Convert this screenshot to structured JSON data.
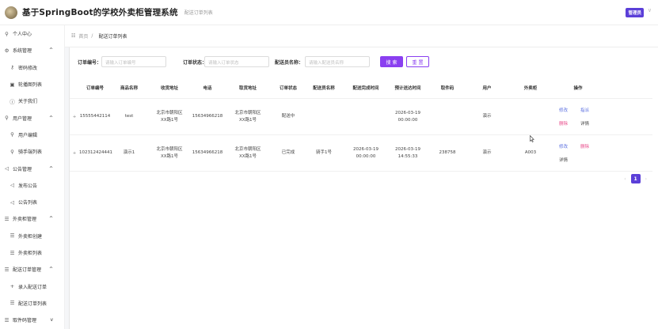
{
  "app": {
    "title": "基于SpringBoot的学校外卖柜管理系统",
    "subtitle": "配送订单列表",
    "admin_label": "管理员",
    "admin_caret": "∨"
  },
  "sidebar": {
    "items": [
      {
        "label": "个人中心",
        "icon": "user-icon",
        "glyph": "⚲"
      },
      {
        "label": "系统管理",
        "icon": "gear-icon",
        "glyph": "⚙",
        "arrow": "^"
      },
      {
        "label": "密码修改",
        "icon": "key-icon",
        "glyph": "⚷",
        "child": true
      },
      {
        "label": "轮播图列表",
        "icon": "image-icon",
        "glyph": "▣",
        "child": true
      },
      {
        "label": "关于我们",
        "icon": "info-icon",
        "glyph": "ⓘ",
        "child": true
      },
      {
        "label": "用户管理",
        "icon": "users-icon",
        "glyph": "⚲",
        "arrow": "^"
      },
      {
        "label": "用户编辑",
        "icon": "user-icon",
        "glyph": "⚲",
        "child": true
      },
      {
        "label": "骑手端列表",
        "icon": "user-icon",
        "glyph": "⚲",
        "child": true
      },
      {
        "label": "公告管理",
        "icon": "speaker-icon",
        "glyph": "◁",
        "arrow": "^"
      },
      {
        "label": "发布公告",
        "icon": "speaker-icon",
        "glyph": "◁",
        "child": true
      },
      {
        "label": "公告列表",
        "icon": "speaker-icon",
        "glyph": "◁",
        "child": true
      },
      {
        "label": "外卖柜管理",
        "icon": "list-icon",
        "glyph": "☰",
        "arrow": "^"
      },
      {
        "label": "外卖柜创建",
        "icon": "list-icon",
        "glyph": "☰",
        "child": true
      },
      {
        "label": "外卖柜列表",
        "icon": "list-icon",
        "glyph": "☰",
        "child": true
      },
      {
        "label": "配送订单管理",
        "icon": "list-icon",
        "glyph": "☰",
        "arrow": "^"
      },
      {
        "label": "录入配送订单",
        "icon": "plus-icon",
        "glyph": "+",
        "child": true
      },
      {
        "label": "配送订单列表",
        "icon": "list-icon",
        "glyph": "☰",
        "child": true
      },
      {
        "label": "取件码管理",
        "icon": "list-icon",
        "glyph": "☰",
        "arrow": "v"
      }
    ]
  },
  "breadcrumb": {
    "icon": "☷",
    "home": "首页",
    "sep": "/",
    "current": "配送订单列表"
  },
  "search": {
    "order_no_label": "订单编号：",
    "order_no_placeholder": "请输入订单编号",
    "order_status_label": "订单状态：",
    "order_status_placeholder": "请输入订单状态",
    "courier_label": "配送员名称：",
    "courier_placeholder": "请输入配送员名称",
    "search_btn": "搜 索",
    "reset_btn": "重 置"
  },
  "table": {
    "headers": [
      "订单编号",
      "商品名称",
      "收货地址",
      "电话",
      "取货地址",
      "订单状态",
      "配送员名称",
      "配送完成时间",
      "预计送达时间",
      "取件码",
      "用户",
      "外卖柜",
      "操作"
    ],
    "rows": [
      {
        "expand": "+",
        "cells": [
          "15555442114",
          "test",
          "北京市朝阳区\nXX路1号",
          "15634966218",
          "北京市朝阳区\nXX路1号",
          "配送中",
          "",
          "",
          "2026-03-19\n00:00:00",
          "",
          "演示",
          ""
        ],
        "actions": [
          "修改",
          "指派",
          "删除",
          "详情"
        ]
      },
      {
        "expand": "+",
        "cells": [
          "102312424441",
          "演示1",
          "北京市朝阳区\nXX路1号",
          "15634966218",
          "北京市朝阳区\nXX路1号",
          "已完成",
          "骑手1号",
          "2026-03-19\n00:00:00",
          "2026-03-19\n14:55:33",
          "238758",
          "演示",
          "A003"
        ],
        "actions": [
          "修改",
          "删除",
          "详情"
        ]
      }
    ]
  },
  "pagination": {
    "prev": "‹",
    "current": "1",
    "next": "›"
  }
}
